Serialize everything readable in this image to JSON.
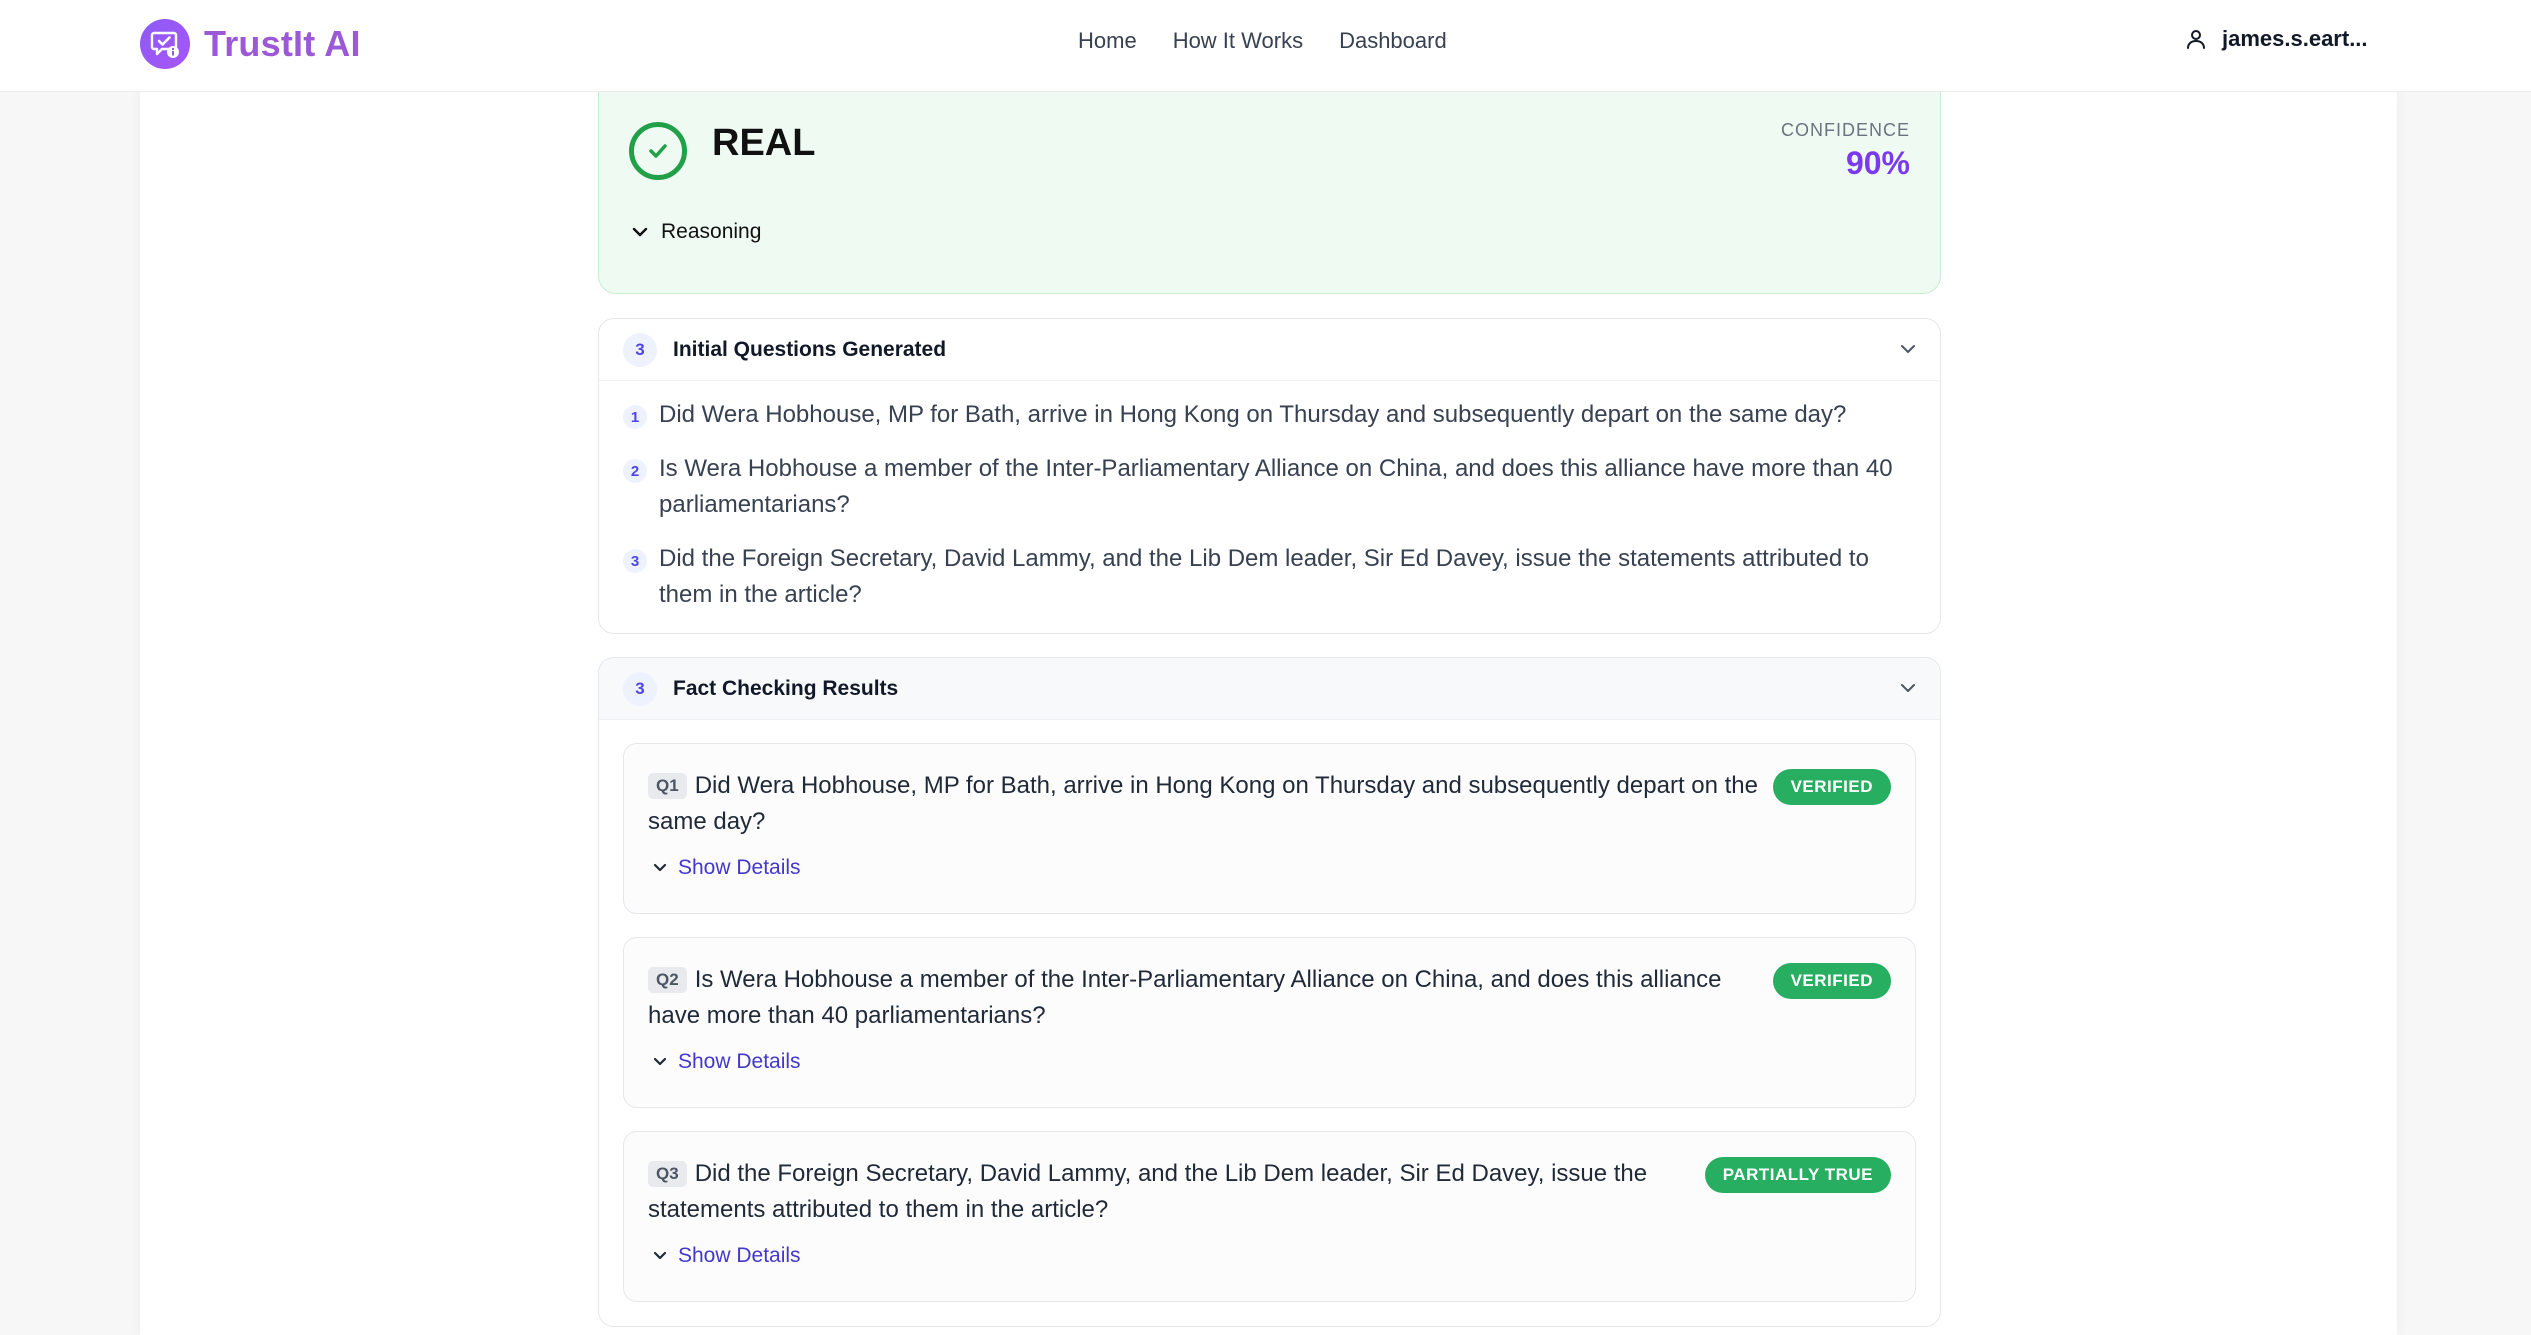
{
  "header": {
    "brand": "TrustIt AI",
    "nav": [
      "Home",
      "How It Works",
      "Dashboard"
    ],
    "user": "james.s.eart..."
  },
  "verdict": {
    "label": "REAL",
    "confidence_label": "CONFIDENCE",
    "confidence_value": "90%",
    "reasoning_label": "Reasoning",
    "color": "#22a049"
  },
  "initial_questions": {
    "count": "3",
    "title": "Initial Questions Generated",
    "items": [
      {
        "num": "1",
        "text": "Did Wera Hobhouse, MP for Bath, arrive in Hong Kong on Thursday and subsequently depart on the same day?"
      },
      {
        "num": "2",
        "text": "Is Wera Hobhouse a member of the Inter-Parliamentary Alliance on China, and does this alliance have more than 40 parliamentarians?"
      },
      {
        "num": "3",
        "text": "Did the Foreign Secretary, David Lammy, and the Lib Dem leader, Sir Ed Davey, issue the statements attributed to them in the article?"
      }
    ]
  },
  "fact_check": {
    "count": "3",
    "title": "Fact Checking Results",
    "show_details_label": "Show Details",
    "items": [
      {
        "tag": "Q1",
        "text": "Did Wera Hobhouse, MP for Bath, arrive in Hong Kong on Thursday and subsequently depart on the same day?",
        "status": "VERIFIED"
      },
      {
        "tag": "Q2",
        "text": "Is Wera Hobhouse a member of the Inter-Parliamentary Alliance on China, and does this alliance have more than 40 parliamentarians?",
        "status": "VERIFIED"
      },
      {
        "tag": "Q3",
        "text": "Did the Foreign Secretary, David Lammy, and the Lib Dem leader, Sir Ed Davey, issue the statements attributed to them in the article?",
        "status": "PARTIALLY TRUE"
      }
    ],
    "status_color": "#27ae60"
  }
}
